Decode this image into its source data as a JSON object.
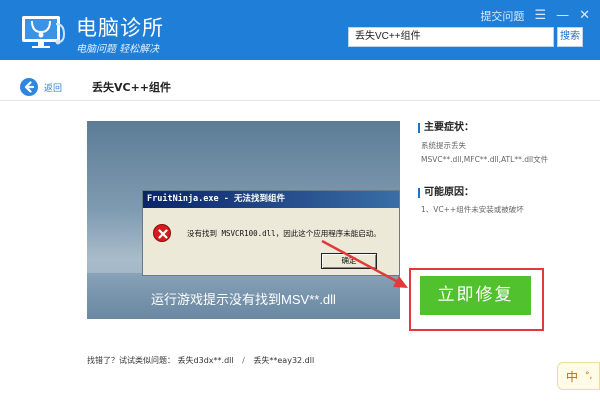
{
  "header": {
    "title": "电脑诊所",
    "subtitle": "电脑问题 轻松解决",
    "feedback_label": "提交问题",
    "menu_icon": "menu-icon",
    "minimize_icon": "minimize-icon",
    "close_icon": "close-icon",
    "search_value": "丢失VC++组件",
    "search_button": "搜索"
  },
  "nav": {
    "back_label": "返回",
    "page_title": "丢失VC++组件"
  },
  "screenshot": {
    "dialog_title": "FruitNinja.exe - 无法找到组件",
    "dialog_message": "没有找到 MSVCR100.dll，因此这个应用程序未能启动。",
    "dialog_ok": "确定",
    "caption": "运行游戏提示没有找到MSV**.dll"
  },
  "symptoms": {
    "heading": "主要症状：",
    "line1": "系统提示丢失",
    "line2": "MSVC**.dll,MFC**.dll,ATL**.dll文件"
  },
  "causes": {
    "heading": "可能原因：",
    "line1": "1、VC++组件未安装或被破坏"
  },
  "fix": {
    "button_label": "立即修复"
  },
  "related": {
    "prefix": "找错了？试试类似问题：",
    "link1": "丢失d3dx**.dll",
    "separator": "/",
    "link2": "丢失**eay32.dll"
  },
  "ime": {
    "lang": "中",
    "extra": "°,"
  },
  "colors": {
    "header_bg": "#1f7fd8",
    "fix_button": "#51c22d",
    "highlight_red": "#e23a3a",
    "accent_blue": "#1e73c6"
  }
}
